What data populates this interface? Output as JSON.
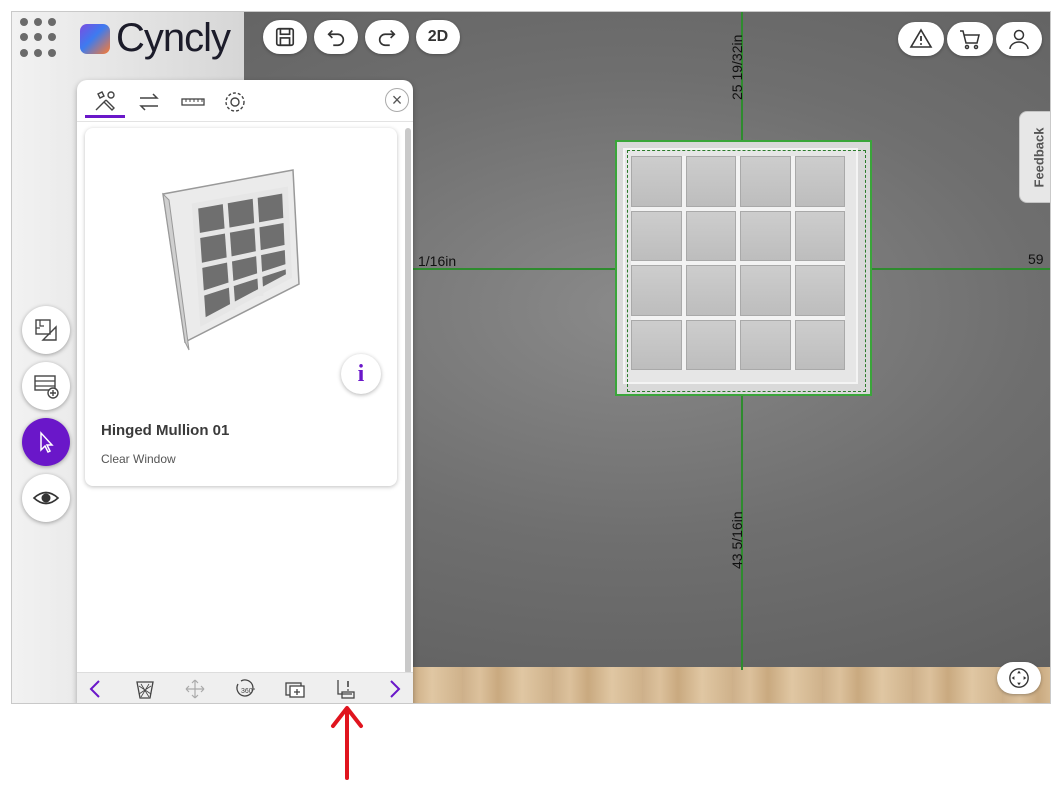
{
  "header": {
    "brand": "Cyncly",
    "view_mode_label": "2D",
    "icons": [
      "menu-icon",
      "save-icon",
      "undo-icon",
      "redo-icon",
      "warning-icon",
      "cart-icon",
      "user-icon"
    ]
  },
  "dimensions": {
    "top": "25 19/32in",
    "left": "1/16in",
    "right": "59",
    "bottom": "43 5/16in"
  },
  "feedback_label": "Feedback",
  "left_tools": [
    "floor-plan-icon",
    "add-cabinet-icon",
    "select-pointer-icon",
    "view-eye-icon"
  ],
  "panel": {
    "tabs": [
      "tools-icon",
      "swap-icon",
      "ruler-icon",
      "settings-icon"
    ],
    "product": {
      "name": "Hinged Mullion 01",
      "subtitle": "Clear Window",
      "info_label": "i"
    },
    "toolbar": [
      "prev-arrow-icon",
      "delete-icon",
      "move-icon",
      "rotate-360-icon",
      "duplicate-icon",
      "alignment-warning-icon",
      "next-arrow-icon"
    ]
  },
  "colors": {
    "accent": "#6a17c9",
    "dimension_line": "#2e8b2e",
    "annotation_arrow": "#e0141e"
  }
}
